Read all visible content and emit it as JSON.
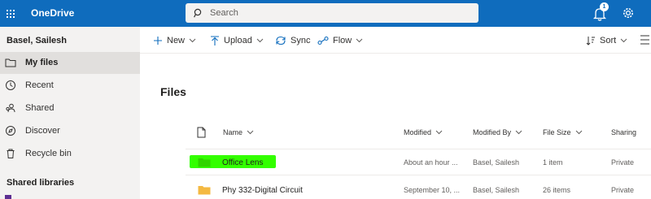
{
  "app": {
    "title": "OneDrive",
    "notification_count": "1"
  },
  "search": {
    "placeholder": "Search"
  },
  "user": {
    "name": "Basel, Sailesh"
  },
  "nav": {
    "items": [
      {
        "label": "My files",
        "icon": "folder-icon",
        "selected": true
      },
      {
        "label": "Recent",
        "icon": "clock-icon",
        "selected": false
      },
      {
        "label": "Shared",
        "icon": "people-icon",
        "selected": false
      },
      {
        "label": "Discover",
        "icon": "compass-icon",
        "selected": false
      },
      {
        "label": "Recycle bin",
        "icon": "trash-icon",
        "selected": false
      }
    ],
    "section_title": "Shared libraries"
  },
  "commands": {
    "new": "New",
    "upload": "Upload",
    "sync": "Sync",
    "flow": "Flow",
    "sort": "Sort"
  },
  "page": {
    "title": "Files"
  },
  "table": {
    "columns": [
      "Name",
      "Modified",
      "Modified By",
      "File Size",
      "Sharing"
    ],
    "rows": [
      {
        "name": "Office Lens",
        "modified": "About an hour ...",
        "modified_by": "Basel, Sailesh",
        "file_size": "1 item",
        "sharing": "Private",
        "highlighted": true
      },
      {
        "name": "Phy 332-Digital Circuit",
        "modified": "September 10, ...",
        "modified_by": "Basel, Sailesh",
        "file_size": "26 items",
        "sharing": "Private",
        "highlighted": false
      }
    ]
  },
  "colors": {
    "suite_bar": "#0f6cbd",
    "highlight": "#33ff00",
    "folder": "#f4b942"
  }
}
